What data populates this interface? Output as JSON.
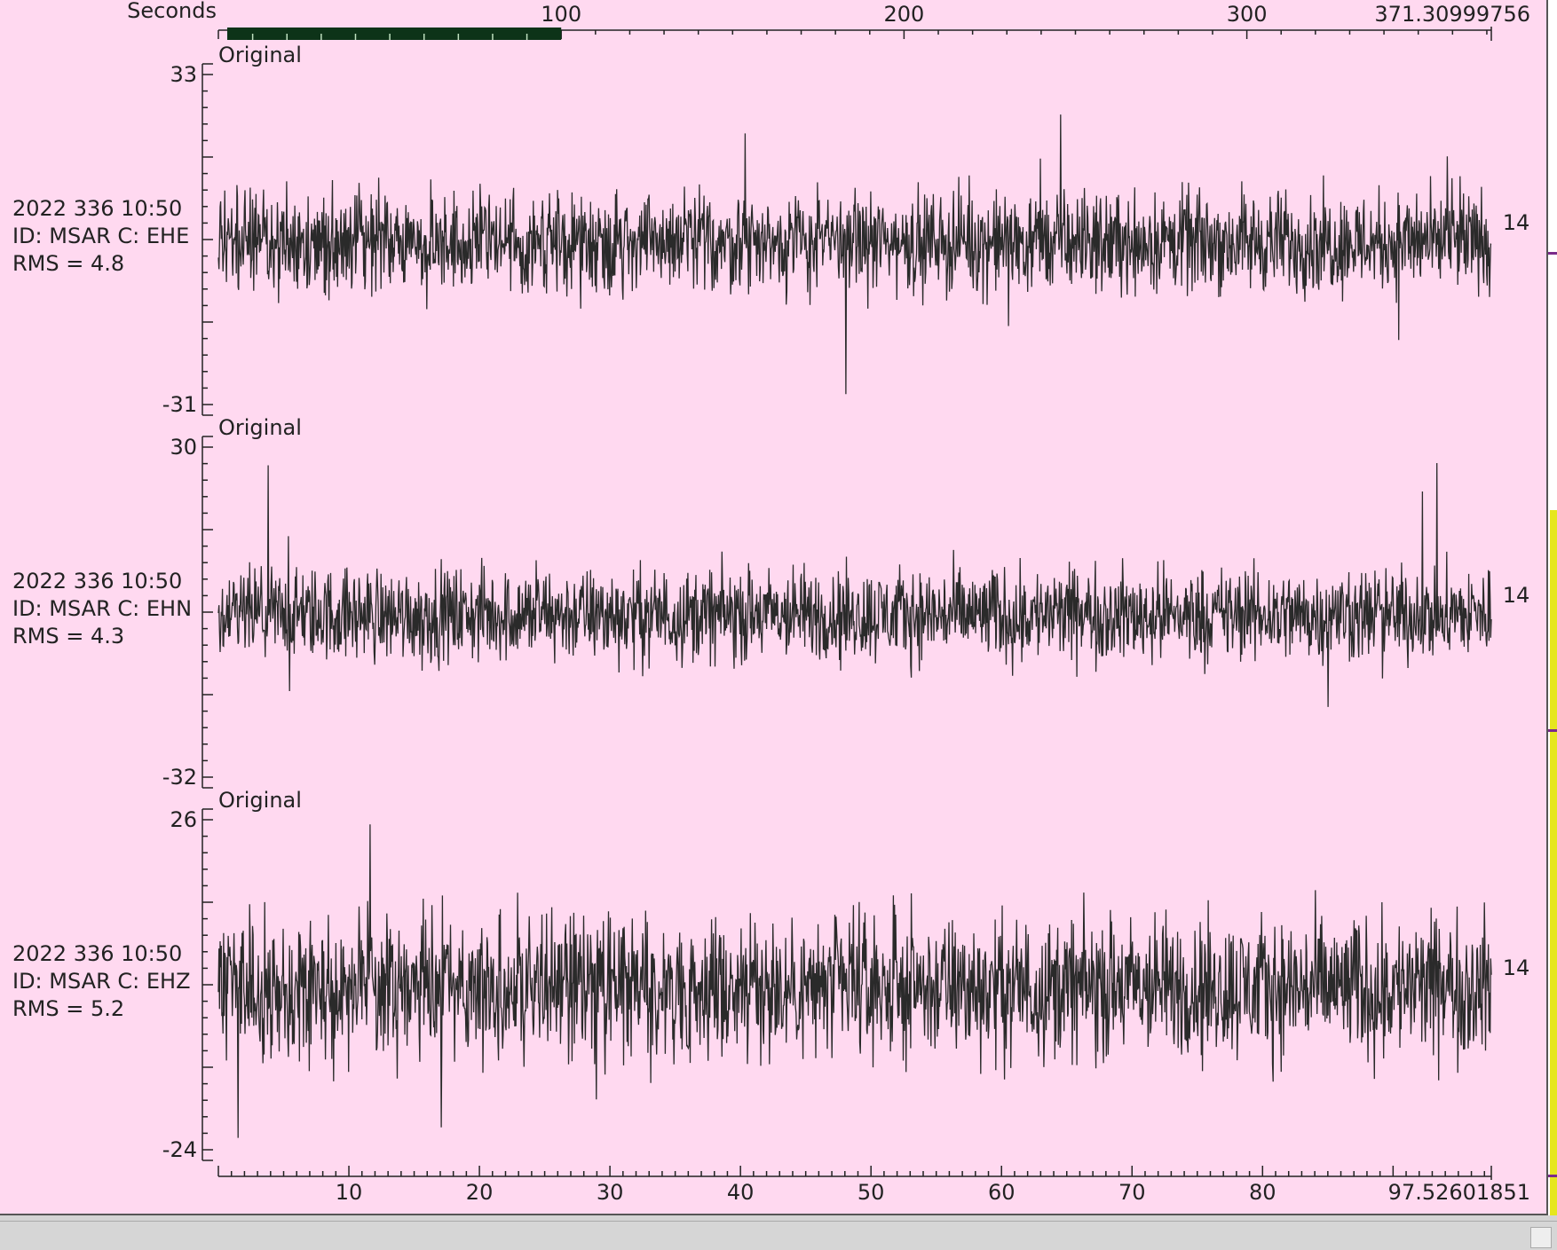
{
  "top_axis": {
    "unit_label": "Seconds",
    "ticks": [
      "100",
      "200",
      "300"
    ],
    "end_label": "371.30999756",
    "range": [
      0,
      371.30999756
    ],
    "selection": [
      0,
      100
    ]
  },
  "bottom_axis": {
    "ticks": [
      "10",
      "20",
      "30",
      "40",
      "50",
      "60",
      "70",
      "80"
    ],
    "end_label": "97.52601851",
    "range": [
      0,
      97.52601851
    ]
  },
  "traces": [
    {
      "title": "Original",
      "ymax_label": "33",
      "ymin_label": "-31",
      "ylim": [
        -31,
        33
      ],
      "time": "2022 336 10:50",
      "id_line": "ID: MSAR C: EHE",
      "rms_line": "RMS = 4.8",
      "rms": 4.8,
      "right_label": "14"
    },
    {
      "title": "Original",
      "ymax_label": "30",
      "ymin_label": "-32",
      "ylim": [
        -32,
        30
      ],
      "time": "2022 336 10:50",
      "id_line": "ID: MSAR C: EHN",
      "rms_line": "RMS = 4.3",
      "rms": 4.3,
      "right_label": "14"
    },
    {
      "title": "Original",
      "ymax_label": "26",
      "ymin_label": "-24",
      "ylim": [
        -24,
        26
      ],
      "time": "2022 336 10:50",
      "id_line": "ID: MSAR C: EHZ",
      "rms_line": "RMS = 5.2",
      "rms": 5.2,
      "right_label": "14"
    }
  ],
  "colors": {
    "plot_background": "#ffd9f0",
    "trace": "#2a2a2a",
    "selection_bar": "#0d3318",
    "side_strip_highlight": "#e6e61e"
  }
}
